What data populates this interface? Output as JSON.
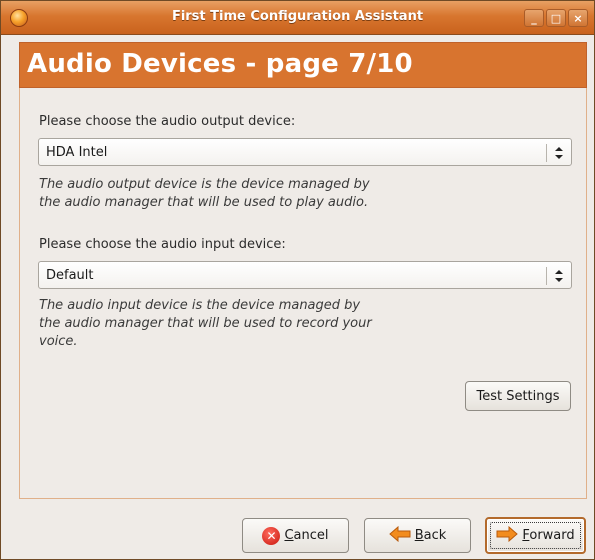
{
  "window": {
    "title": "First Time Configuration Assistant",
    "controls": {
      "minimize": "_",
      "maximize": "□",
      "close": "×"
    }
  },
  "header": {
    "title": "Audio Devices - page 7/10"
  },
  "output": {
    "label": "Please choose the audio output device:",
    "selected": "HDA Intel",
    "description_line1": "The audio output device is the device managed by",
    "description_line2": "the audio manager that will be used to play audio."
  },
  "input": {
    "label": "Please choose the audio input device:",
    "selected": "Default",
    "description_line1": "The audio input device is the device managed by",
    "description_line2": "the audio manager that will be used to record your",
    "description_line3": "voice."
  },
  "buttons": {
    "test": "Test Settings",
    "cancel_mnemonic": "C",
    "cancel_rest": "ancel",
    "back_mnemonic": "B",
    "back_rest": "ack",
    "forward_mnemonic": "F",
    "forward_rest": "orward"
  },
  "icons": {
    "app": "app-logo-icon",
    "cancel": "cancel-icon",
    "back": "back-arrow-icon",
    "forward": "forward-arrow-icon",
    "combo": "combo-arrows-icon"
  },
  "colors": {
    "accent": "#d8742f",
    "window_bg": "#efebe7",
    "arrow_orange": "#f28c1e"
  }
}
